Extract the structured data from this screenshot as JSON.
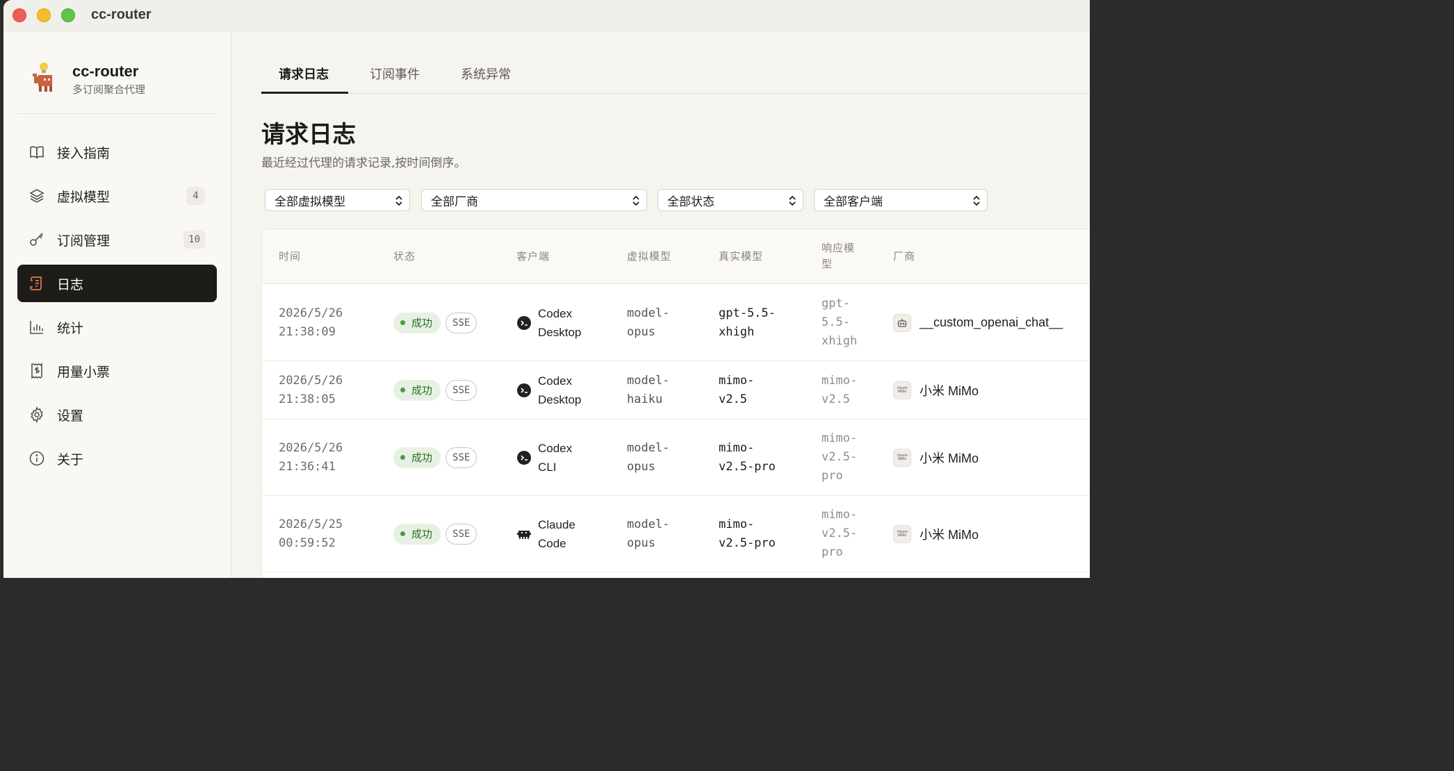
{
  "window": {
    "title": "cc-router"
  },
  "brand": {
    "name": "cc-router",
    "subtitle": "多订阅聚合代理"
  },
  "sidebar": {
    "items": [
      {
        "label": "接入指南",
        "icon": "book-icon",
        "count": null,
        "active": false
      },
      {
        "label": "虚拟模型",
        "icon": "layers-icon",
        "count": "4",
        "active": false
      },
      {
        "label": "订阅管理",
        "icon": "key-icon",
        "count": "10",
        "active": false
      },
      {
        "label": "日志",
        "icon": "scroll-icon",
        "count": null,
        "active": true
      },
      {
        "label": "统计",
        "icon": "bar-chart-icon",
        "count": null,
        "active": false
      },
      {
        "label": "用量小票",
        "icon": "receipt-icon",
        "count": null,
        "active": false
      },
      {
        "label": "设置",
        "icon": "gear-icon",
        "count": null,
        "active": false
      },
      {
        "label": "关于",
        "icon": "info-icon",
        "count": null,
        "active": false
      }
    ]
  },
  "tabs": [
    {
      "label": "请求日志",
      "active": true
    },
    {
      "label": "订阅事件",
      "active": false
    },
    {
      "label": "系统异常",
      "active": false
    }
  ],
  "page": {
    "title": "请求日志",
    "subtitle": "最近经过代理的请求记录,按时间倒序。"
  },
  "filters": [
    {
      "value": "全部虚拟模型"
    },
    {
      "value": "全部厂商"
    },
    {
      "value": "全部状态"
    },
    {
      "value": "全部客户端"
    }
  ],
  "table": {
    "headers": {
      "time": "时间",
      "status": "状态",
      "client": "客户端",
      "virtual_model": "虚拟模型",
      "real_model": "真实模型",
      "response_model_1": "响应模",
      "response_model_2": "型",
      "vendor": "厂商"
    },
    "rows": [
      {
        "date": "2026/5/26",
        "clock": "21:38:09",
        "status": "成功",
        "mode": "SSE",
        "client_line1": "Codex",
        "client_line2": "Desktop",
        "client_icon": "codex-icon",
        "vm_line1": "model-",
        "vm_line2": "opus",
        "rm_lines": [
          "gpt-5.5-",
          "xhigh"
        ],
        "resp_lines": [
          "gpt-",
          "5.5-",
          "xhigh"
        ],
        "vendor": "__custom_openai_chat__",
        "vendor_icon": "robot-icon"
      },
      {
        "date": "2026/5/26",
        "clock": "21:38:05",
        "status": "成功",
        "mode": "SSE",
        "client_line1": "Codex",
        "client_line2": "Desktop",
        "client_icon": "codex-icon",
        "vm_line1": "model-",
        "vm_line2": "haiku",
        "rm_lines": [
          "mimo-",
          "v2.5"
        ],
        "resp_lines": [
          "mimo-",
          "v2.5"
        ],
        "vendor": "小米 MiMo",
        "vendor_icon": "xiaomi-mimo-icon"
      },
      {
        "date": "2026/5/26",
        "clock": "21:36:41",
        "status": "成功",
        "mode": "SSE",
        "client_line1": "Codex",
        "client_line2": "CLI",
        "client_icon": "codex-icon",
        "vm_line1": "model-",
        "vm_line2": "opus",
        "rm_lines": [
          "mimo-",
          "v2.5-pro"
        ],
        "resp_lines": [
          "mimo-",
          "v2.5-",
          "pro"
        ],
        "vendor": "小米 MiMo",
        "vendor_icon": "xiaomi-mimo-icon"
      },
      {
        "date": "2026/5/25",
        "clock": "00:59:52",
        "status": "成功",
        "mode": "SSE",
        "client_line1": "Claude",
        "client_line2": "Code",
        "client_icon": "claude-code-icon",
        "vm_line1": "model-",
        "vm_line2": "opus",
        "rm_lines": [
          "mimo-",
          "v2.5-pro"
        ],
        "resp_lines": [
          "mimo-",
          "v2.5-",
          "pro"
        ],
        "vendor": "小米 MiMo",
        "vendor_icon": "xiaomi-mimo-icon"
      }
    ]
  },
  "vendor_icon_text": {
    "mimo_line1": "Xiaomi",
    "mimo_line2": "MiMo"
  },
  "colors": {
    "accent_dark": "#1e1c19",
    "success_bg": "#e6f1e3",
    "success_text": "#2f6b2a",
    "active_icon": "#e07b4f"
  }
}
